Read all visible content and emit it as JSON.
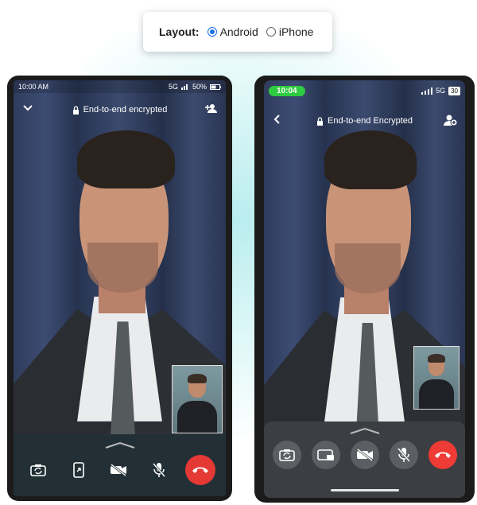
{
  "layout_selector": {
    "label": "Layout:",
    "options": [
      {
        "label": "Android",
        "selected": true
      },
      {
        "label": "iPhone",
        "selected": false
      }
    ]
  },
  "android": {
    "status": {
      "time": "10:00 AM",
      "network": "5G",
      "battery": "50%"
    },
    "header": {
      "title": "End-to-end encrypted",
      "left_icon": "chevron-down-icon",
      "right_icon": "add-person-icon"
    },
    "controls": [
      "flip-camera-icon",
      "screen-share-icon",
      "video-off-icon",
      "mic-off-icon",
      "end-call-icon"
    ]
  },
  "iphone": {
    "status": {
      "time": "10:04",
      "network": "5G",
      "battery": "30"
    },
    "header": {
      "title": "End-to-end Encrypted",
      "left_icon": "chevron-left-icon",
      "right_icon": "add-person-icon"
    },
    "controls": [
      "flip-camera-icon",
      "screen-share-icon",
      "video-off-icon",
      "mic-off-icon",
      "end-call-icon"
    ]
  },
  "colors": {
    "end_call": "#e53935",
    "iphone_time_pill": "#2ecc40",
    "radio_selected": "#1a73e8"
  }
}
